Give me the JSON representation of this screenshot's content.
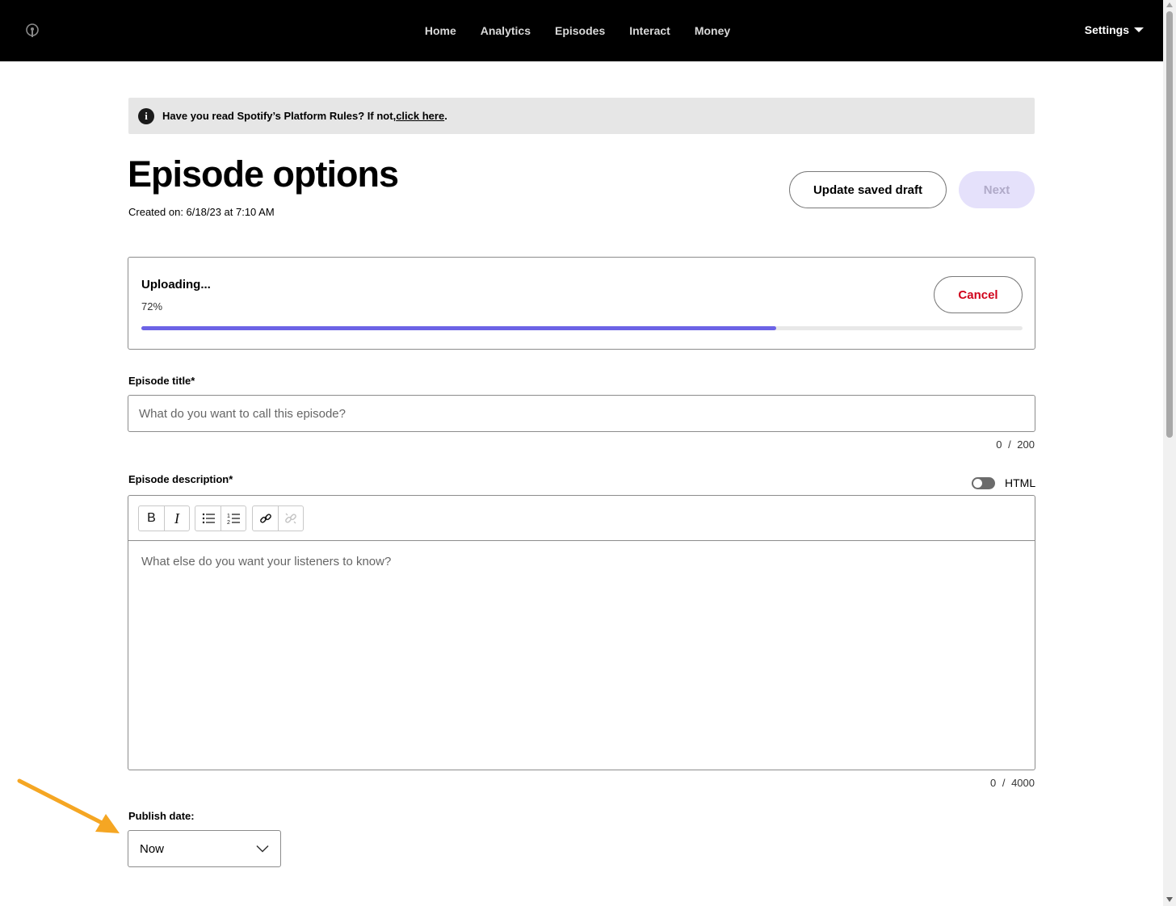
{
  "nav": {
    "items": [
      "Home",
      "Analytics",
      "Episodes",
      "Interact",
      "Money"
    ],
    "settings_label": "Settings",
    "logo_icon": "podcast-logo-icon"
  },
  "banner": {
    "text": "Have you read Spotify’s Platform Rules? If not, ",
    "link_text": "click here",
    "suffix": ".",
    "icon": "info-icon"
  },
  "header": {
    "title": "Episode options",
    "created": "Created on: 6/18/23 at 7:10 AM",
    "draft_button": "Update saved draft",
    "next_button": "Next"
  },
  "upload": {
    "status": "Uploading...",
    "percent_text": "72%",
    "progress": 0.72,
    "cancel_button": "Cancel",
    "accent": "#6c63e6"
  },
  "title_field": {
    "label": "Episode title*",
    "placeholder": "What do you want to call this episode?",
    "value": "",
    "counter": "0 / 200"
  },
  "description_field": {
    "label": "Episode description*",
    "html_toggle_label": "HTML",
    "html_toggle_on": false,
    "toolbar": [
      "bold",
      "italic",
      "bullet-list",
      "numbered-list",
      "link",
      "unlink"
    ],
    "bold_glyph": "B",
    "italic_glyph": "I",
    "placeholder": "What else do you want your listeners to know?",
    "counter": "0 / 4000"
  },
  "publish": {
    "label": "Publish date:",
    "selected": "Now"
  },
  "colors": {
    "cancel": "#d0021b",
    "annotation_arrow": "#f5a623"
  }
}
